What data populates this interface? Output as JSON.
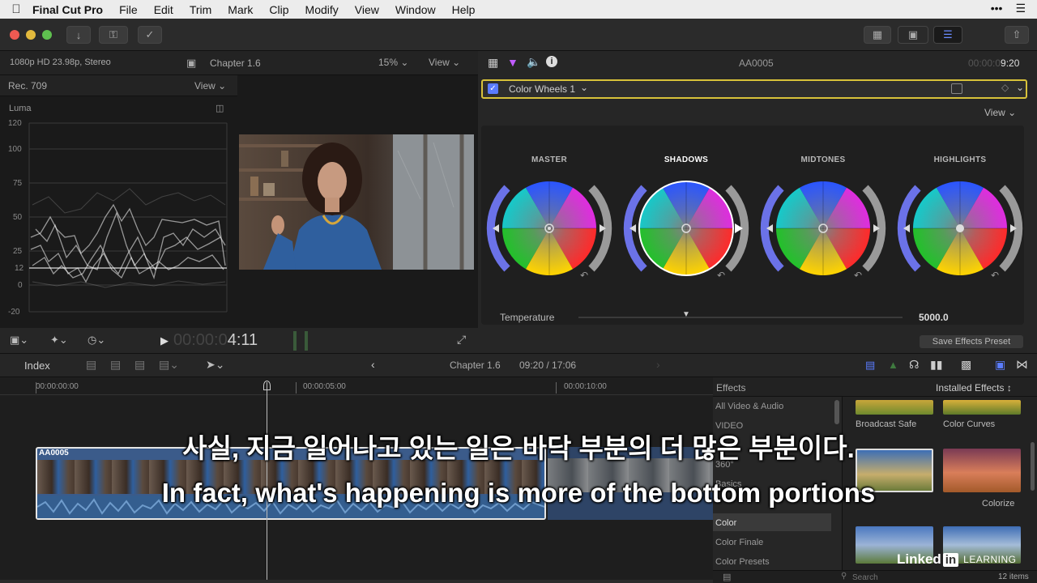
{
  "menubar": {
    "app_name": "Final Cut Pro",
    "items": [
      "File",
      "Edit",
      "Trim",
      "Mark",
      "Clip",
      "Modify",
      "View",
      "Window",
      "Help"
    ],
    "right_icons": [
      "more-icon",
      "list-icon"
    ]
  },
  "viewer_header": {
    "format": "1080p HD 23.98p, Stereo",
    "project": "Chapter 1.6",
    "zoom": "15%",
    "view_label": "View"
  },
  "scopes": {
    "colorspace": "Rec. 709",
    "view_label": "View",
    "scope_name": "Luma",
    "scale": [
      "120",
      "100",
      "75",
      "50",
      "25",
      "12",
      "0",
      "-20"
    ]
  },
  "inspector": {
    "clip_name": "AA0005",
    "timecode_dim": "00:00:0",
    "timecode": "9:20",
    "effect_name": "Color Wheels 1",
    "view_label": "View",
    "wheels": [
      "MASTER",
      "SHADOWS",
      "MIDTONES",
      "HIGHLIGHTS"
    ],
    "temperature_label": "Temperature",
    "temperature_value": "5000.0",
    "save_preset": "Save Effects Preset"
  },
  "playback": {
    "timecode_dim": "00:00:0",
    "timecode": "4:11"
  },
  "timeline_bar": {
    "index_label": "Index",
    "project": "Chapter 1.6",
    "position": "09:20 / 17:06"
  },
  "timeline": {
    "ruler": [
      "00:00:00:00",
      "00:00:05:00",
      "00:00:10:00"
    ],
    "clip_name": "AA0005"
  },
  "effects": {
    "title": "Effects",
    "installed": "Installed Effects",
    "categories": [
      "All Video & Audio",
      "VIDEO",
      "360°",
      "Basics",
      "Color",
      "Color Finale",
      "Color Presets"
    ],
    "selected_category": "Color",
    "thumbs": [
      "Broadcast Safe",
      "Color Curves",
      "",
      "Colorize"
    ],
    "search_placeholder": "Search",
    "count": "12 items"
  },
  "subtitles": {
    "korean": "사실, 지금 일어나고 있는 일은 바닥 부분의 더 많은 부분이다.",
    "english": "In fact, what's happening is more of the bottom portions"
  },
  "watermark": {
    "brand": "Linked",
    "in": "in",
    "learning": "LEARNING"
  },
  "colors": {
    "accent": "#5a7cff",
    "selection": "#d8c23a",
    "clip": "#3b5b8a"
  }
}
